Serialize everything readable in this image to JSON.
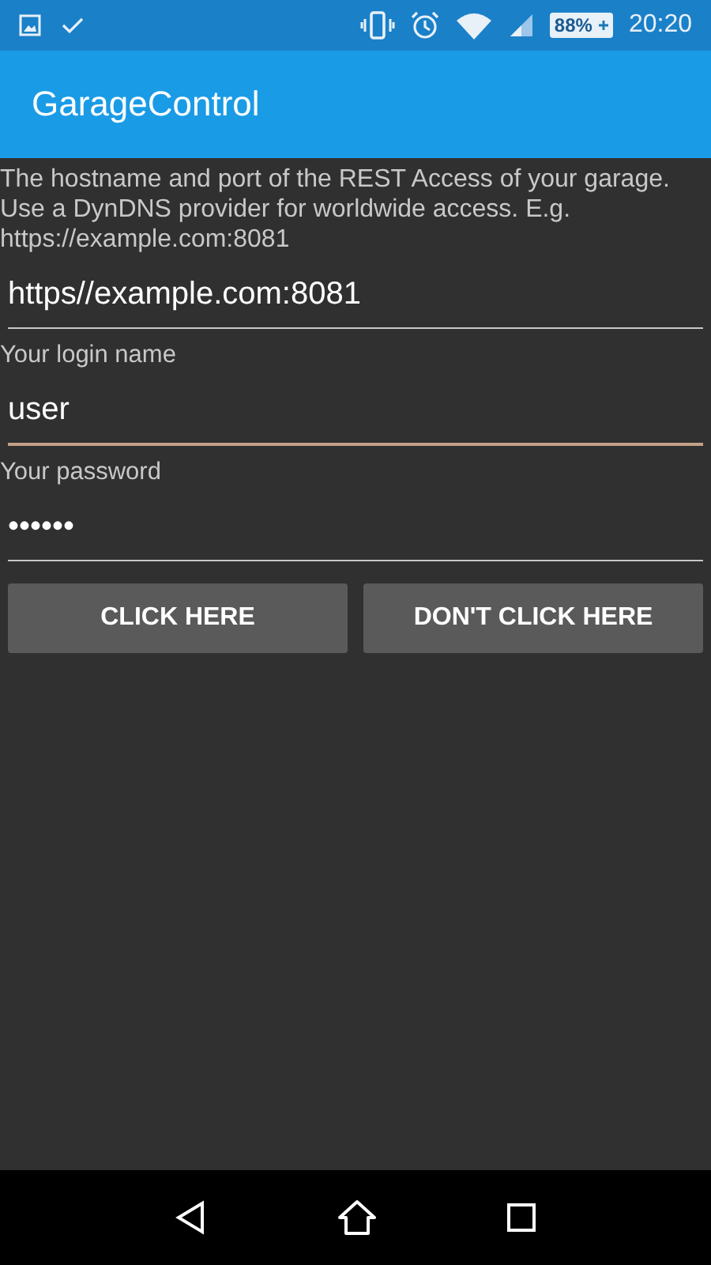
{
  "status_bar": {
    "battery": "88%",
    "charging": true,
    "time": "20:20"
  },
  "app_bar": {
    "title": "GarageControl"
  },
  "form": {
    "description": "The hostname and port of the REST Access of your garage. Use a DynDNS provider for worldwide access. E.g. https://example.com:8081",
    "fields": [
      {
        "value": "https//example.com:8081",
        "focused": false
      },
      {
        "label": "Your login name",
        "value": "user",
        "focused": true
      },
      {
        "label": "Your password",
        "value": "••••••",
        "focused": false
      }
    ],
    "buttons": [
      "CLICK HERE",
      "DON'T CLICK HERE"
    ]
  }
}
